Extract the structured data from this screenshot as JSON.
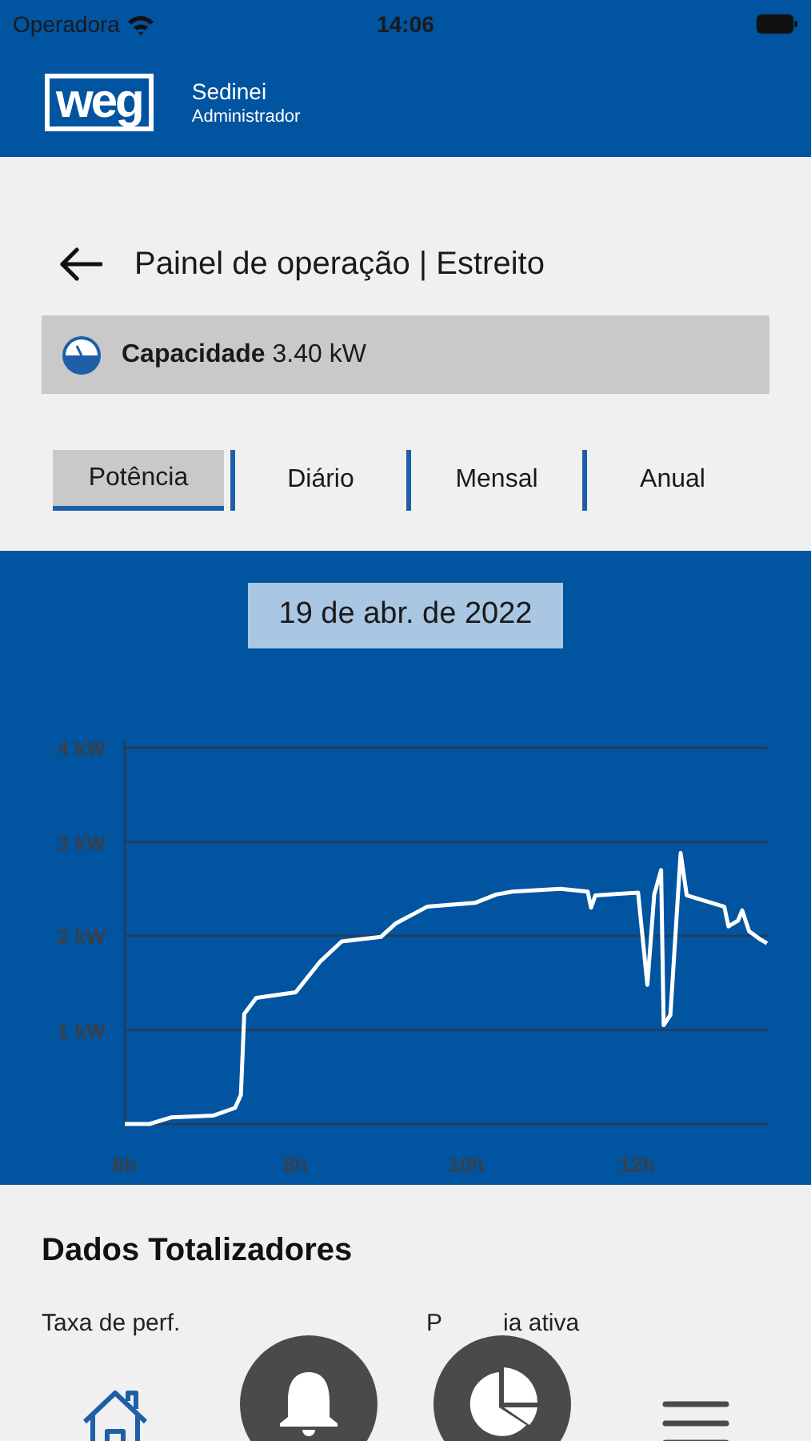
{
  "status_bar": {
    "carrier": "Operadora",
    "time": "14:06"
  },
  "header": {
    "logo_text": "weg",
    "user_name": "Sedinei",
    "user_role": "Administrador"
  },
  "page": {
    "title": "Painel de operação | Estreito"
  },
  "capacity": {
    "label": "Capacidade",
    "value": "3.40 kW"
  },
  "tabs": [
    {
      "label": "Potência",
      "selected": true
    },
    {
      "label": "Diário",
      "selected": false
    },
    {
      "label": "Mensal",
      "selected": false
    },
    {
      "label": "Anual",
      "selected": false
    }
  ],
  "date": "19 de abr. de 2022",
  "chart_data": {
    "type": "line",
    "xlim": [
      6,
      13.53
    ],
    "ylim": [
      0,
      4
    ],
    "xticks": [
      {
        "value": 6,
        "label": "6h"
      },
      {
        "value": 8,
        "label": "8h"
      },
      {
        "value": 10,
        "label": "10h"
      },
      {
        "value": 12,
        "label": "12h"
      }
    ],
    "yticks": [
      {
        "value": 1,
        "label": "1 kW"
      },
      {
        "value": 2,
        "label": "2 kW"
      },
      {
        "value": 3,
        "label": "3 kW"
      },
      {
        "value": 4,
        "label": "4 kW"
      }
    ],
    "x": [
      6,
      6.29,
      6.54,
      7.04,
      7.29,
      7.36,
      7.4,
      7.54,
      8,
      8.29,
      8.54,
      9,
      9.17,
      9.54,
      10.1,
      10.35,
      10.54,
      11.1,
      11.42,
      11.46,
      11.51,
      12.01,
      12.12,
      12.2,
      12.28,
      12.31,
      12.39,
      12.51,
      12.58,
      13.02,
      13.07,
      13.18,
      13.23,
      13.31,
      13.43,
      13.52
    ],
    "grid": true,
    "series": [
      {
        "color": "#ffffff",
        "values": [
          0,
          0,
          0.07,
          0.09,
          0.17,
          0.31,
          1.17,
          1.34,
          1.4,
          1.73,
          1.94,
          1.99,
          2.13,
          2.31,
          2.35,
          2.44,
          2.47,
          2.5,
          2.47,
          2.3,
          2.43,
          2.46,
          1.48,
          2.44,
          2.7,
          1.05,
          1.16,
          2.88,
          2.43,
          2.31,
          2.1,
          2.16,
          2.27,
          2.05,
          1.97,
          1.92
        ]
      }
    ]
  },
  "totals": {
    "title": "Dados Totalizadores",
    "labels": [
      {
        "parts": [
          "Taxa de perf."
        ]
      },
      {
        "parts": [
          "P",
          "ia ativa"
        ]
      }
    ]
  },
  "bottom_nav": [
    {
      "kind": "home",
      "selected": true
    },
    {
      "kind": "bell",
      "selected": false
    },
    {
      "kind": "pie",
      "selected": false
    },
    {
      "kind": "menu",
      "selected": false
    }
  ]
}
